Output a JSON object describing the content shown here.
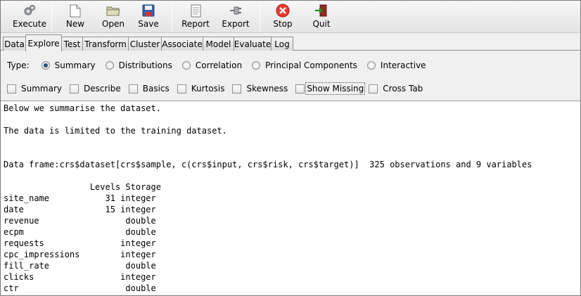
{
  "toolbar": {
    "execute": "Execute",
    "new": "New",
    "open": "Open",
    "save": "Save",
    "report": "Report",
    "export": "Export",
    "stop": "Stop",
    "quit": "Quit"
  },
  "tabs": [
    "Data",
    "Explore",
    "Test",
    "Transform",
    "Cluster",
    "Associate",
    "Model",
    "Evaluate",
    "Log"
  ],
  "type_row": {
    "label": "Type:",
    "options": [
      "Summary",
      "Distributions",
      "Correlation",
      "Principal Components",
      "Interactive"
    ],
    "selected": "Summary"
  },
  "checkboxes": [
    "Summary",
    "Describe",
    "Basics",
    "Kurtosis",
    "Skewness",
    "Show Missing",
    "Cross Tab"
  ],
  "output": {
    "lines": [
      "Below we summarise the dataset.",
      "",
      "The data is limited to the training dataset.",
      "",
      "",
      "Data frame:crs$dataset[crs$sample, c(crs$input, crs$risk, crs$target)]  325 observations and 9 variables",
      "",
      "                 Levels Storage",
      "site_name           31 integer",
      "date                15 integer",
      "revenue                 double",
      "ecpm                    double",
      "requests               integer",
      "cpc_impressions        integer",
      "fill_rate               double",
      "clicks                 integer",
      "ctr                     double"
    ]
  },
  "colors": {
    "stop_red": "#e53a2e",
    "quit_red": "#c0392b",
    "radio_dot": "#2b4e7a"
  }
}
